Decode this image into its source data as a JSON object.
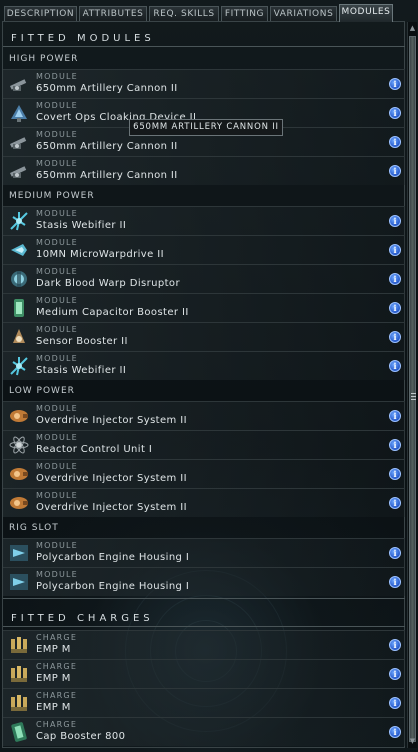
{
  "tabs": [
    "DESCRIPTION",
    "ATTRIBUTES",
    "REQ. SKILLS",
    "FITTING",
    "VARIATIONS",
    "MODULES"
  ],
  "active_tab": "MODULES",
  "fitted_modules": {
    "title": "FITTED MODULES",
    "groups": [
      {
        "label": "HIGH POWER",
        "items": [
          {
            "kind": "MODULE",
            "name": "650mm Artillery Cannon II",
            "icon": "artillery-icon"
          },
          {
            "kind": "MODULE",
            "name": "Covert Ops Cloaking Device II",
            "icon": "cloak-icon"
          },
          {
            "kind": "MODULE",
            "name": "650mm Artillery Cannon II",
            "icon": "artillery-icon"
          },
          {
            "kind": "MODULE",
            "name": "650mm Artillery Cannon II",
            "icon": "artillery-icon"
          }
        ]
      },
      {
        "label": "MEDIUM POWER",
        "items": [
          {
            "kind": "MODULE",
            "name": "Stasis Webifier II",
            "icon": "webifier-icon"
          },
          {
            "kind": "MODULE",
            "name": "10MN MicroWarpdrive II",
            "icon": "microwarpdrive-icon"
          },
          {
            "kind": "MODULE",
            "name": "Dark Blood Warp Disruptor",
            "icon": "warp-disruptor-icon"
          },
          {
            "kind": "MODULE",
            "name": "Medium Capacitor Booster II",
            "icon": "capacitor-booster-icon"
          },
          {
            "kind": "MODULE",
            "name": "Sensor Booster II",
            "icon": "sensor-booster-icon"
          },
          {
            "kind": "MODULE",
            "name": "Stasis Webifier II",
            "icon": "webifier-icon"
          }
        ]
      },
      {
        "label": "LOW POWER",
        "items": [
          {
            "kind": "MODULE",
            "name": "Overdrive Injector System II",
            "icon": "overdrive-icon"
          },
          {
            "kind": "MODULE",
            "name": "Reactor Control Unit I",
            "icon": "reactor-icon"
          },
          {
            "kind": "MODULE",
            "name": "Overdrive Injector System II",
            "icon": "overdrive-icon"
          },
          {
            "kind": "MODULE",
            "name": "Overdrive Injector System II",
            "icon": "overdrive-icon"
          }
        ]
      },
      {
        "label": "RIG SLOT",
        "items": [
          {
            "kind": "MODULE",
            "name": "Polycarbon Engine Housing I",
            "icon": "rig-icon"
          },
          {
            "kind": "MODULE",
            "name": "Polycarbon Engine Housing I",
            "icon": "rig-icon"
          }
        ]
      }
    ]
  },
  "fitted_charges": {
    "title": "FITTED CHARGES",
    "items": [
      {
        "kind": "CHARGE",
        "name": "EMP M",
        "icon": "ammo-icon"
      },
      {
        "kind": "CHARGE",
        "name": "EMP M",
        "icon": "ammo-icon"
      },
      {
        "kind": "CHARGE",
        "name": "EMP M",
        "icon": "ammo-icon"
      },
      {
        "kind": "CHARGE",
        "name": "Cap Booster 800",
        "icon": "cap-booster-charge-icon"
      }
    ]
  },
  "tooltip": "650MM ARTILLERY CANNON II",
  "info_button_symbol": "i",
  "colors": {
    "info_blue": "#2f6ee0",
    "background": "#0d1417",
    "text": "#dfe5e7"
  }
}
